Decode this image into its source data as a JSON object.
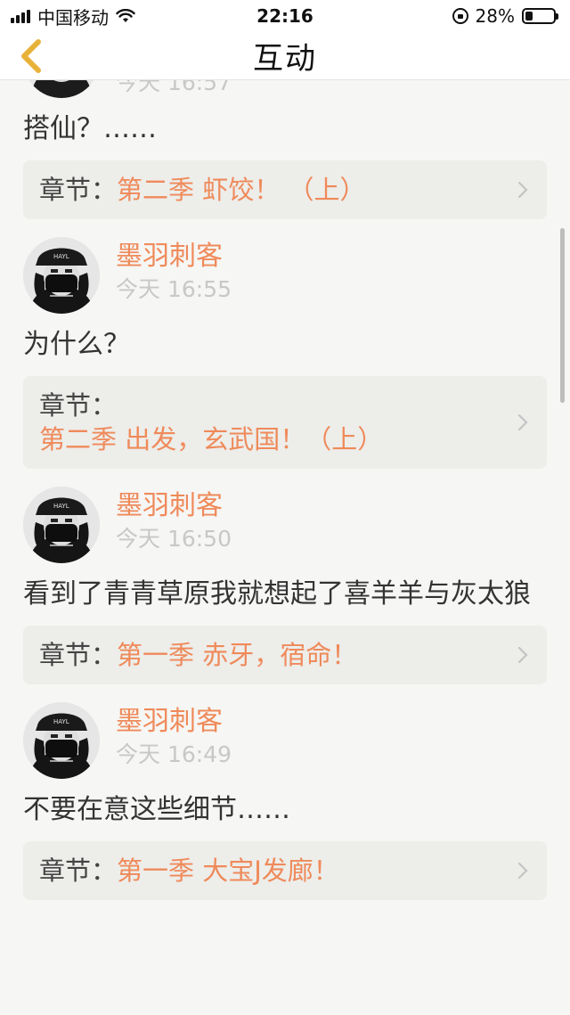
{
  "status_bar": {
    "carrier": "中国移动",
    "time": "22:16",
    "battery": "28%",
    "battery_level": 0.28
  },
  "nav": {
    "title": "互动"
  },
  "top_partial": {
    "time_fragment": "今天 16:57",
    "content": "搭仙？……",
    "chapter_label": "章节：",
    "chapter_name": "第二季  虾饺！  （上）"
  },
  "posts": [
    {
      "username": "墨羽刺客",
      "time": "今天 16:55",
      "content": "为什么？",
      "chapter_label": "章节：",
      "chapter_name": "第二季  出发，玄武国！（上）"
    },
    {
      "username": "墨羽刺客",
      "time": "今天 16:50",
      "content": "看到了青青草原我就想起了喜羊羊与灰太狼",
      "chapter_label": "章节：",
      "chapter_name": "第一季  赤牙，宿命！"
    },
    {
      "username": "墨羽刺客",
      "time": "今天 16:49",
      "content": "不要在意这些细节……",
      "chapter_label": "章节：",
      "chapter_name": "第一季  大宝J发廊！"
    }
  ]
}
